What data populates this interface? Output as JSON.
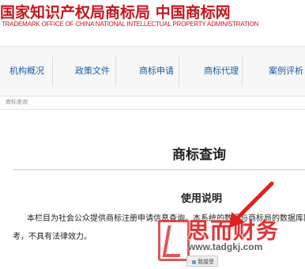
{
  "header": {
    "title": "国家知识产权局商标局 中国商标网",
    "subtitle": "TRADEMARK OFFICE OF CHINA NATIONAL INTELLECTUAL PROPERTY ADMINISTRATION"
  },
  "nav": {
    "items": [
      {
        "label": "机构概况"
      },
      {
        "label": "政策文件"
      },
      {
        "label": "商标申请"
      },
      {
        "label": "商标代理"
      },
      {
        "label": "案例评析"
      }
    ]
  },
  "breadcrumb": "商标查询",
  "main": {
    "page_title": "商标查询",
    "usage_heading": "使用说明",
    "paragraph_lines": [
      "本栏目为社会公众提供商标注册申请信息查询。本系统的数据与商标局的数据库同步更新，",
      "考，不具有法律效力。"
    ],
    "accept_button_label": "我接受"
  },
  "watermark": {
    "brand": "思而财务",
    "url": "www.tadgkj.com"
  },
  "colors": {
    "brand_red": "#c8161d",
    "nav_link": "#1a5da8",
    "watermark_red": "#dc1e1e"
  }
}
